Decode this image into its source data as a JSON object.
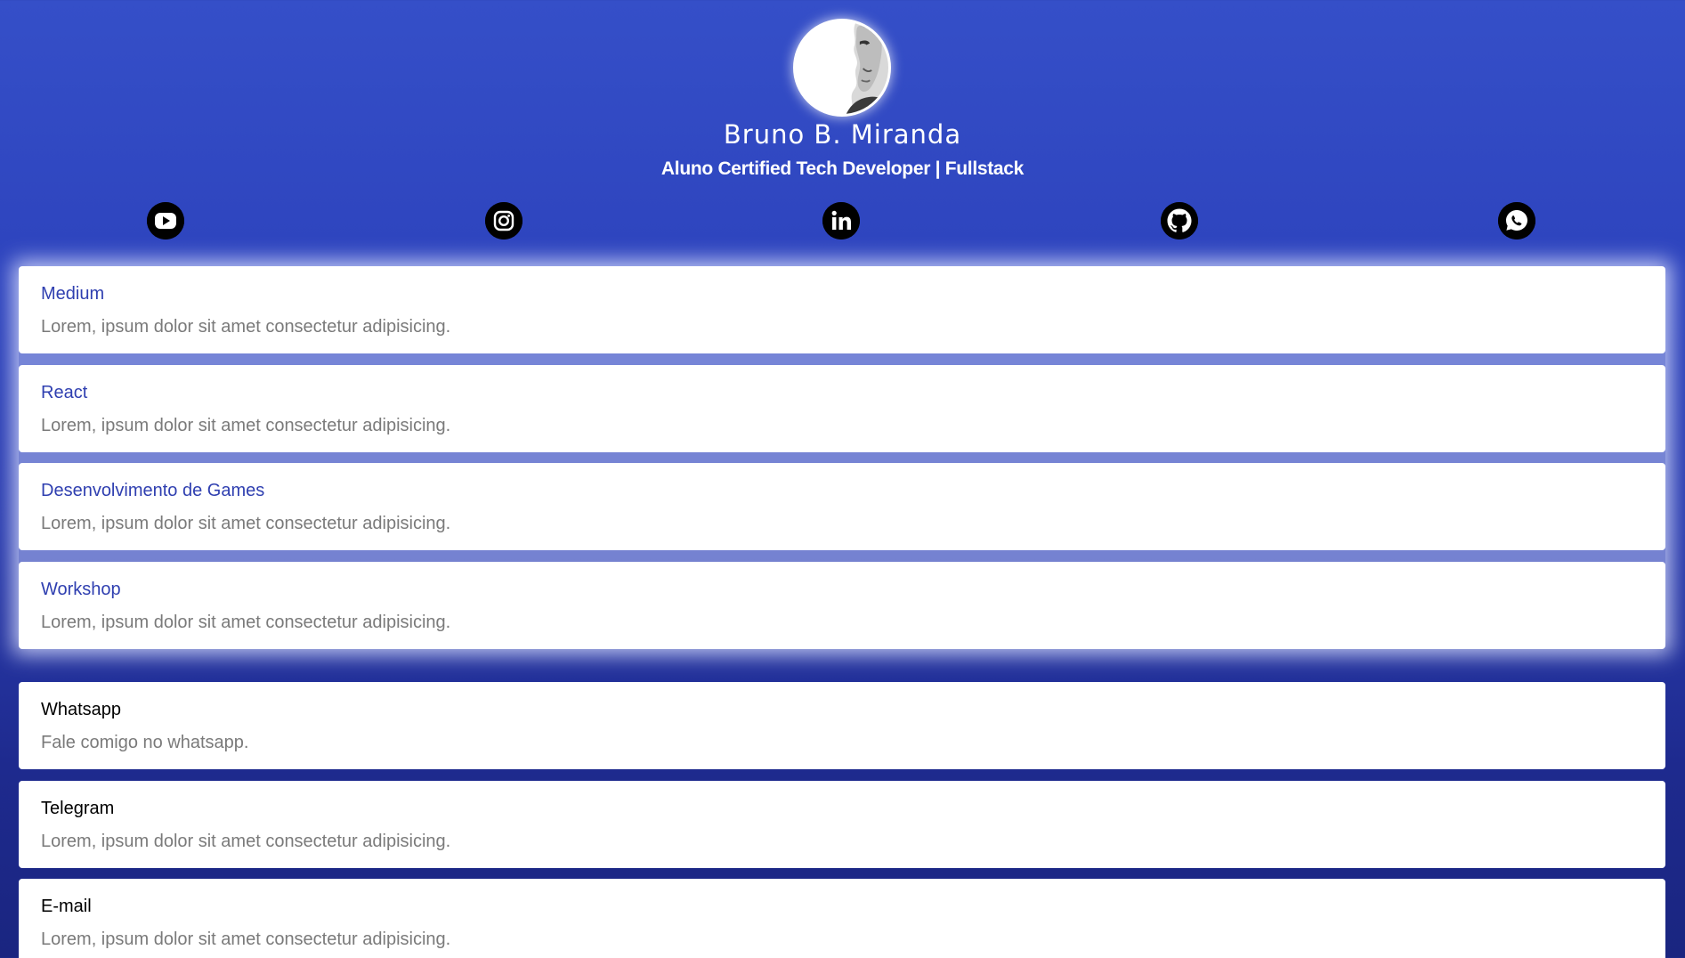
{
  "profile": {
    "name": "Bruno B. Miranda",
    "role": "Aluno Certified Tech Developer | Fullstack"
  },
  "social": [
    {
      "icon": "youtube-icon"
    },
    {
      "icon": "instagram-icon"
    },
    {
      "icon": "linkedin-icon"
    },
    {
      "icon": "github-icon"
    },
    {
      "icon": "whatsapp-icon"
    }
  ],
  "featured_links": [
    {
      "title": "Medium",
      "description": "Lorem, ipsum dolor sit amet consectetur adipisicing."
    },
    {
      "title": "React",
      "description": "Lorem, ipsum dolor sit amet consectetur adipisicing."
    },
    {
      "title": "Desenvolvimento de Games",
      "description": "Lorem, ipsum dolor sit amet consectetur adipisicing."
    },
    {
      "title": "Workshop",
      "description": "Lorem, ipsum dolor sit amet consectetur adipisicing."
    }
  ],
  "contact_links": [
    {
      "title": "Whatsapp",
      "description": "Fale comigo no whatsapp."
    },
    {
      "title": "Telegram",
      "description": "Lorem, ipsum dolor sit amet consectetur adipisicing."
    },
    {
      "title": "E-mail",
      "description": "Lorem, ipsum dolor sit amet consectetur adipisicing."
    }
  ],
  "colors": {
    "background": "#2d43bd",
    "accent_title": "#2f3fb0",
    "description": "#7a7a7a"
  }
}
